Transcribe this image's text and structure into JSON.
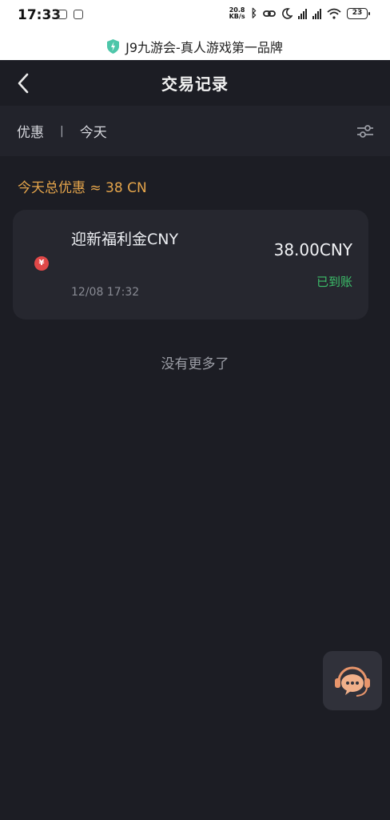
{
  "status_bar": {
    "time": "17:33",
    "net_speed_value": "20.8",
    "net_speed_unit": "KB/s",
    "battery": "23"
  },
  "site": {
    "title": "J9九游会-真人游戏第一品牌"
  },
  "header": {
    "title": "交易记录"
  },
  "filters": {
    "type": "优惠",
    "separator": "|",
    "date": "今天"
  },
  "summary": {
    "text": "今天总优惠 ≈ 38 CN"
  },
  "records": [
    {
      "title": "迎新福利金CNY",
      "time": "12/08 17:32",
      "amount": "38.00CNY",
      "status": "已到账",
      "currency_symbol": "¥"
    }
  ],
  "footer": {
    "no_more": "没有更多了"
  },
  "colors": {
    "background": "#1c1d24",
    "accent": "#e5a54b",
    "success": "#3cbf6a",
    "currency_badge": "#e04848"
  },
  "icons": {
    "back": "chevron-left-icon",
    "filter": "sliders-icon",
    "currency": "yuan-coin-icon",
    "support": "customer-service-icon",
    "site": "shield-icon"
  }
}
